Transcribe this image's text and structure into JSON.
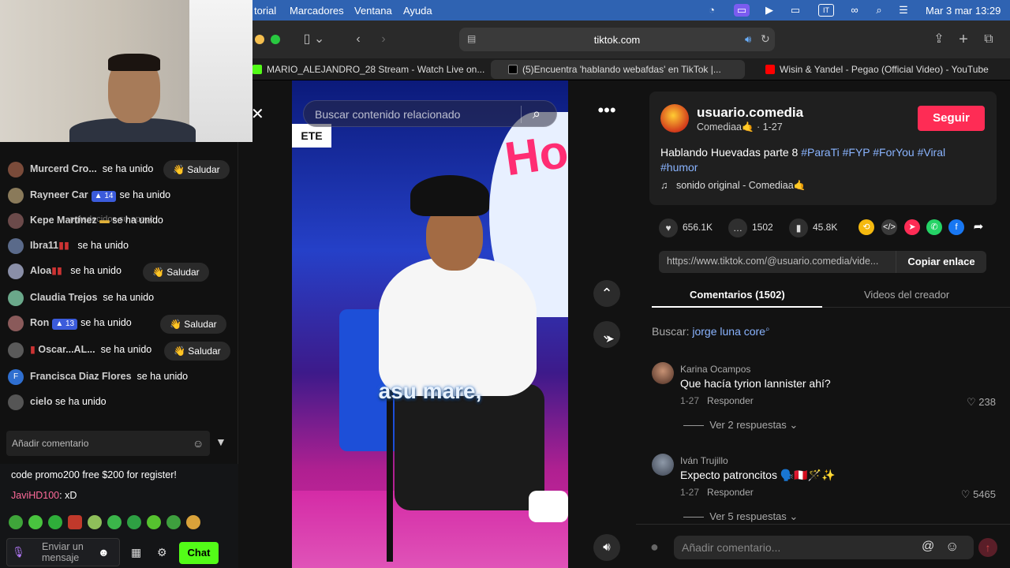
{
  "menubar": {
    "items": [
      "torial",
      "Marcadores",
      "Ventana",
      "Ayuda"
    ],
    "clock": "Mar 3 mar 13:29"
  },
  "browser": {
    "url": "tiktok.com",
    "tabs": [
      {
        "label": "MARIO_ALEJANDRO_28 Stream - Watch Live on..."
      },
      {
        "label": "(5)Encuentra 'hablando webafdas' en TikTok |..."
      },
      {
        "label": "Wisin & Yandel - Pegao (Official Video) - YouTube"
      }
    ]
  },
  "stream_chat": {
    "faded_line": "agradecidos su apoyo.",
    "rows": [
      {
        "name": "Murcerd Cro...",
        "text": "se ha unido",
        "saludar": true
      },
      {
        "name": "Rayneer Car",
        "badge": "14",
        "text": "se ha unido",
        "saludar": false
      },
      {
        "name": "Kepe Martínez",
        "text": "se ha unido",
        "saludar": false
      },
      {
        "name": "Ibra11",
        "text": "se ha unido",
        "saludar": false
      },
      {
        "name": "Aloa",
        "text": "se ha unido",
        "saludar": true
      },
      {
        "name": "Claudia Trejos",
        "text": "se ha unido",
        "saludar": false
      },
      {
        "name": "Ron",
        "badge": "13",
        "text": "se ha unido",
        "saludar": true
      },
      {
        "name": "Oscar...AL...",
        "text": "se ha unido",
        "saludar": true
      },
      {
        "name": "Francisca Diaz Flores",
        "text": "se ha unido",
        "saludar": false
      },
      {
        "name": "cielo",
        "text": "se ha unido",
        "saludar": false
      }
    ],
    "saludar_label": "Saludar",
    "add_comment_placeholder": "Añadir comentario"
  },
  "kick_chat": {
    "promo": "code promo200 free $200 for register!",
    "msg_user": "JaviHD100",
    "msg_text": ": xD",
    "send_placeholder_1": "Enviar un",
    "send_placeholder_2": "mensaje",
    "chat_button": "Chat"
  },
  "video": {
    "search_placeholder": "Buscar contenido relacionado",
    "caption": "asu mare,",
    "sign": "ETE"
  },
  "post": {
    "username": "usuario.comedia",
    "subline": "Comediaa🤙 · 1-27",
    "follow": "Seguir",
    "desc_plain": "Hablando Huevadas parte 8 ",
    "hashtags_1": "#ParaTi #FYP #ForYou #Viral",
    "hashtags_2": "#humor",
    "sound": "sonido original - Comediaa🤙",
    "likes": "656.1K",
    "comments": "1502",
    "saves": "45.8K",
    "link": "https://www.tiktok.com/@usuario.comedia/vide...",
    "copy_link": "Copiar enlace"
  },
  "comments_tabs": {
    "comments": "Comentarios (1502)",
    "creator_videos": "Videos del creador"
  },
  "search_suggestion": {
    "label": "Buscar:",
    "term": "jorge luna core"
  },
  "comments": [
    {
      "name": "Karina Ocampos",
      "text": "Que hacía tyrion lannister ahí?",
      "date": "1-27",
      "reply": "Responder",
      "likes": "238",
      "replies": "Ver 2 respuestas"
    },
    {
      "name": "Iván Trujillo",
      "text": "Expecto patroncitos 🗣️🇵🇪🪄✨",
      "date": "1-27",
      "reply": "Responder",
      "likes": "5465",
      "replies": "Ver 5 respuestas"
    }
  ],
  "comment_input": {
    "placeholder": "Añadir comentario..."
  },
  "colors": {
    "follow": "#fe2c55",
    "menubar": "#2f63b2",
    "kick_green": "#53fc18",
    "hashtag": "#8ab4ff"
  }
}
